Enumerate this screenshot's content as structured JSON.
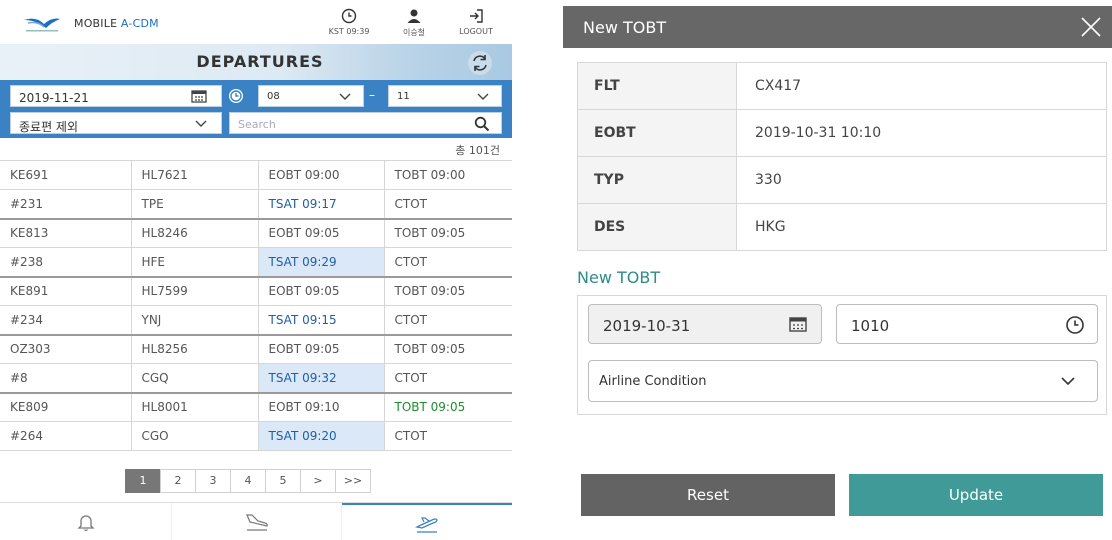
{
  "app": {
    "logo_prefix": "MOBILE ",
    "logo_accent": "A-CDM",
    "clock_label": "KST 09:39",
    "user_label": "이승철",
    "logout_label": "LOGOUT",
    "page_title": "DEPARTURES"
  },
  "filters": {
    "date": "2019-11-21",
    "from_hour": "08",
    "to_hour": "11",
    "exclusion": "종료편 제외",
    "search_placeholder": "Search"
  },
  "result_count": "총 101건",
  "flights": [
    {
      "r1": [
        "KE691",
        "HL7621",
        "EOBT 09:00",
        "TOBT 09:00"
      ],
      "r2": [
        "#231",
        "TPE",
        "TSAT 09:17",
        "CTOT"
      ],
      "tsat_highlight": false,
      "tobt_green": false
    },
    {
      "r1": [
        "KE813",
        "HL8246",
        "EOBT 09:05",
        "TOBT 09:05"
      ],
      "r2": [
        "#238",
        "HFE",
        "TSAT 09:29",
        "CTOT"
      ],
      "tsat_highlight": true,
      "tobt_green": false
    },
    {
      "r1": [
        "KE891",
        "HL7599",
        "EOBT 09:05",
        "TOBT 09:05"
      ],
      "r2": [
        "#234",
        "YNJ",
        "TSAT 09:15",
        "CTOT"
      ],
      "tsat_highlight": false,
      "tobt_green": false
    },
    {
      "r1": [
        "OZ303",
        "HL8256",
        "EOBT 09:05",
        "TOBT 09:05"
      ],
      "r2": [
        "#8",
        "CGQ",
        "TSAT 09:32",
        "CTOT"
      ],
      "tsat_highlight": true,
      "tobt_green": false
    },
    {
      "r1": [
        "KE809",
        "HL8001",
        "EOBT 09:10",
        "TOBT 09:05"
      ],
      "r2": [
        "#264",
        "CGO",
        "TSAT 09:20",
        "CTOT"
      ],
      "tsat_highlight": true,
      "tobt_green": true
    }
  ],
  "pagination": {
    "pages": [
      "1",
      "2",
      "3",
      "4",
      "5"
    ],
    "next": ">",
    "last": ">>",
    "active": "1"
  },
  "bottom_nav": [
    {
      "icon": "bell-icon"
    },
    {
      "icon": "arrival-icon"
    },
    {
      "icon": "departure-icon",
      "active": true
    }
  ],
  "modal": {
    "title": "New TOBT",
    "fields": [
      {
        "key": "FLT",
        "value": "CX417"
      },
      {
        "key": "EOBT",
        "value": "2019-10-31 10:10"
      },
      {
        "key": "TYP",
        "value": "330"
      },
      {
        "key": "DES",
        "value": "HKG"
      }
    ],
    "section_label": "New TOBT",
    "tobt_date": "2019-10-31",
    "tobt_time": "1010",
    "condition": "Airline Condition",
    "reset_label": "Reset",
    "update_label": "Update"
  },
  "colors": {
    "filter_bar": "#3a82c4",
    "tsat_text": "#1f5ea8",
    "tsat_highlight": "#dbe8f7",
    "tobt_green": "#1e8e2f",
    "modal_header": "#676767",
    "update_button": "#3f9a98",
    "reset_button": "#636363",
    "section_label": "#2e8b8b"
  }
}
